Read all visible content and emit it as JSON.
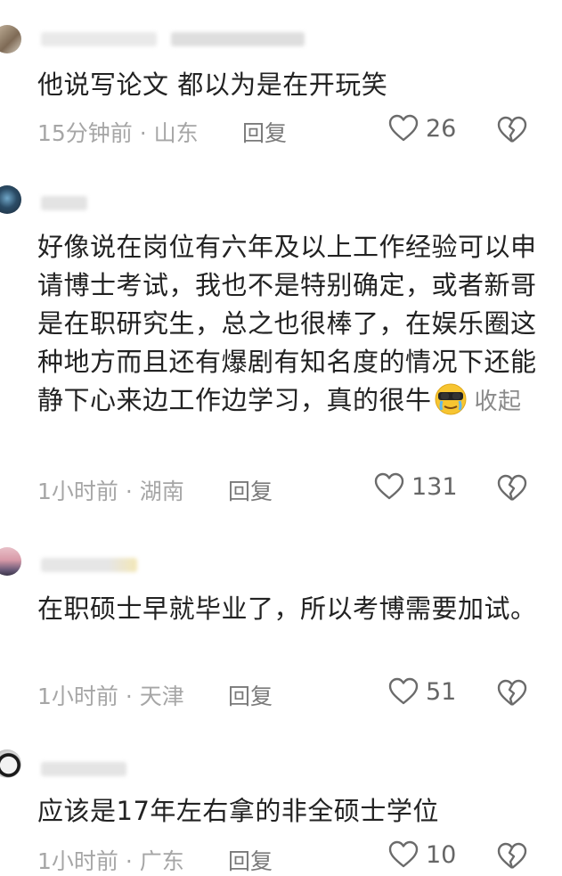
{
  "comments": [
    {
      "text": "他说写论文 都以为是在开玩笑",
      "time": "15分钟前",
      "location": "山东",
      "reply_label": "回复",
      "likes": "26"
    },
    {
      "text": "好像说在岗位有六年及以上工作经验可以申请博士考试，我也不是特别确定，或者新哥是在职研究生，总之也很棒了，在娱乐圈这种地方而且还有爆剧有知名度的情况下还能静下心来边工作边学习，真的很牛",
      "collapse_label": "收起",
      "time": "1小时前",
      "location": "湖南",
      "reply_label": "回复",
      "likes": "131"
    },
    {
      "text": "在职硕士早就毕业了，所以考博需要加试。",
      "time": "1小时前",
      "location": "天津",
      "reply_label": "回复",
      "likes": "51"
    },
    {
      "text": "应该是17年左右拿的非全硕士学位",
      "time": "1小时前",
      "location": "广东",
      "reply_label": "回复",
      "likes": "10"
    }
  ],
  "separator": " · ",
  "icons": {
    "like": "heart-outline-icon",
    "dislike": "broken-heart-icon",
    "emoji": "sunglasses-tears-emoji"
  },
  "colors": {
    "text": "#222222",
    "meta": "#a6a6a6",
    "icon": "#6b6b6b"
  }
}
